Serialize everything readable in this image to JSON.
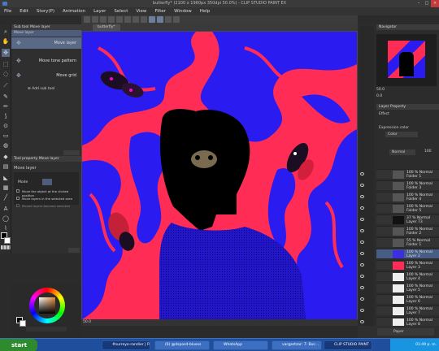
{
  "window": {
    "title": "butterfly* (2100 x 1960px 350dpi 50.0%) - CLIP STUDIO PAINT EX"
  },
  "menu": [
    "File",
    "Edit",
    "Story(P)",
    "Animation",
    "Layer",
    "Select",
    "View",
    "Filter",
    "Window",
    "Help"
  ],
  "canvas_tab": "butterfly*",
  "subtool": {
    "header": "Sub tool  Move layer",
    "selected": "Move layer",
    "items": [
      "Move layer",
      "Move tone pattern",
      "Move grid"
    ],
    "add": "Add sub tool"
  },
  "toolprop": {
    "header": "Tool property  Move layer",
    "title": "Move layer",
    "mode_label": "Mode",
    "options": [
      "Move the object at the clicked position",
      "Move layers in the selected area",
      "Moved layers become selected"
    ]
  },
  "navigator": {
    "header": "Navigator",
    "zoom": "50.0",
    "angle": "0.0"
  },
  "layer_property": {
    "header": "Layer Property",
    "effect": "Effect",
    "expression_color": "Expression color",
    "color": "Color"
  },
  "layers": {
    "blend": "Normal",
    "opacity": "100",
    "list": [
      {
        "t1": "100 % Normal",
        "t2": "Folder 1"
      },
      {
        "t1": "100 % Normal",
        "t2": "Folder 3"
      },
      {
        "t1": "100 % Normal",
        "t2": "Folder 4"
      },
      {
        "t1": "100 % Normal",
        "t2": "Folder 5"
      },
      {
        "t1": "37 % Normal",
        "t2": "Layer 73"
      },
      {
        "t1": "100 % Normal",
        "t2": "Folder 2"
      },
      {
        "t1": "55 % Normal",
        "t2": "Folder 1"
      },
      {
        "t1": "100 % Normal",
        "t2": "Layer 2"
      },
      {
        "t1": "100 % Normal",
        "t2": "Layer 3"
      },
      {
        "t1": "100 % Normal",
        "t2": "Layer 4"
      },
      {
        "t1": "100 % Normal",
        "t2": "Layer 5"
      },
      {
        "t1": "100 % Normal",
        "t2": "Layer 6"
      },
      {
        "t1": "100 % Normal",
        "t2": "Layer 7"
      },
      {
        "t1": "100 % Normal",
        "t2": "Layer 8"
      },
      {
        "t1": "",
        "t2": "Paper"
      }
    ]
  },
  "status": {
    "zoom": "50.0"
  },
  "taskbar": {
    "start": "start",
    "tasks": [
      "#surreyo-randier | P...",
      "(6) @dsposd-bluess",
      "WhatsApp",
      "vargastzar: 7: Boc...",
      "CLIP STUDIO PAINT"
    ],
    "time": "01:49 p. m."
  },
  "colors": {
    "accent": "#485d86",
    "taskbar": "#1f4e9c",
    "canvas_red": "#ff2d55",
    "canvas_blue": "#2a1cf0"
  }
}
